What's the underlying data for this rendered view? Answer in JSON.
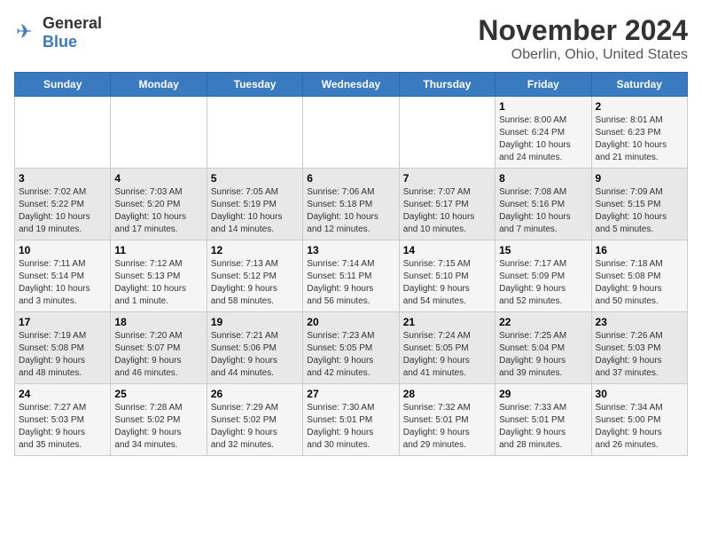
{
  "app": {
    "logo_general": "General",
    "logo_blue": "Blue"
  },
  "title": "November 2024",
  "subtitle": "Oberlin, Ohio, United States",
  "days_of_week": [
    "Sunday",
    "Monday",
    "Tuesday",
    "Wednesday",
    "Thursday",
    "Friday",
    "Saturday"
  ],
  "weeks": [
    [
      {
        "day": "",
        "info": ""
      },
      {
        "day": "",
        "info": ""
      },
      {
        "day": "",
        "info": ""
      },
      {
        "day": "",
        "info": ""
      },
      {
        "day": "",
        "info": ""
      },
      {
        "day": "1",
        "info": "Sunrise: 8:00 AM\nSunset: 6:24 PM\nDaylight: 10 hours\nand 24 minutes."
      },
      {
        "day": "2",
        "info": "Sunrise: 8:01 AM\nSunset: 6:23 PM\nDaylight: 10 hours\nand 21 minutes."
      }
    ],
    [
      {
        "day": "3",
        "info": "Sunrise: 7:02 AM\nSunset: 5:22 PM\nDaylight: 10 hours\nand 19 minutes."
      },
      {
        "day": "4",
        "info": "Sunrise: 7:03 AM\nSunset: 5:20 PM\nDaylight: 10 hours\nand 17 minutes."
      },
      {
        "day": "5",
        "info": "Sunrise: 7:05 AM\nSunset: 5:19 PM\nDaylight: 10 hours\nand 14 minutes."
      },
      {
        "day": "6",
        "info": "Sunrise: 7:06 AM\nSunset: 5:18 PM\nDaylight: 10 hours\nand 12 minutes."
      },
      {
        "day": "7",
        "info": "Sunrise: 7:07 AM\nSunset: 5:17 PM\nDaylight: 10 hours\nand 10 minutes."
      },
      {
        "day": "8",
        "info": "Sunrise: 7:08 AM\nSunset: 5:16 PM\nDaylight: 10 hours\nand 7 minutes."
      },
      {
        "day": "9",
        "info": "Sunrise: 7:09 AM\nSunset: 5:15 PM\nDaylight: 10 hours\nand 5 minutes."
      }
    ],
    [
      {
        "day": "10",
        "info": "Sunrise: 7:11 AM\nSunset: 5:14 PM\nDaylight: 10 hours\nand 3 minutes."
      },
      {
        "day": "11",
        "info": "Sunrise: 7:12 AM\nSunset: 5:13 PM\nDaylight: 10 hours\nand 1 minute."
      },
      {
        "day": "12",
        "info": "Sunrise: 7:13 AM\nSunset: 5:12 PM\nDaylight: 9 hours\nand 58 minutes."
      },
      {
        "day": "13",
        "info": "Sunrise: 7:14 AM\nSunset: 5:11 PM\nDaylight: 9 hours\nand 56 minutes."
      },
      {
        "day": "14",
        "info": "Sunrise: 7:15 AM\nSunset: 5:10 PM\nDaylight: 9 hours\nand 54 minutes."
      },
      {
        "day": "15",
        "info": "Sunrise: 7:17 AM\nSunset: 5:09 PM\nDaylight: 9 hours\nand 52 minutes."
      },
      {
        "day": "16",
        "info": "Sunrise: 7:18 AM\nSunset: 5:08 PM\nDaylight: 9 hours\nand 50 minutes."
      }
    ],
    [
      {
        "day": "17",
        "info": "Sunrise: 7:19 AM\nSunset: 5:08 PM\nDaylight: 9 hours\nand 48 minutes."
      },
      {
        "day": "18",
        "info": "Sunrise: 7:20 AM\nSunset: 5:07 PM\nDaylight: 9 hours\nand 46 minutes."
      },
      {
        "day": "19",
        "info": "Sunrise: 7:21 AM\nSunset: 5:06 PM\nDaylight: 9 hours\nand 44 minutes."
      },
      {
        "day": "20",
        "info": "Sunrise: 7:23 AM\nSunset: 5:05 PM\nDaylight: 9 hours\nand 42 minutes."
      },
      {
        "day": "21",
        "info": "Sunrise: 7:24 AM\nSunset: 5:05 PM\nDaylight: 9 hours\nand 41 minutes."
      },
      {
        "day": "22",
        "info": "Sunrise: 7:25 AM\nSunset: 5:04 PM\nDaylight: 9 hours\nand 39 minutes."
      },
      {
        "day": "23",
        "info": "Sunrise: 7:26 AM\nSunset: 5:03 PM\nDaylight: 9 hours\nand 37 minutes."
      }
    ],
    [
      {
        "day": "24",
        "info": "Sunrise: 7:27 AM\nSunset: 5:03 PM\nDaylight: 9 hours\nand 35 minutes."
      },
      {
        "day": "25",
        "info": "Sunrise: 7:28 AM\nSunset: 5:02 PM\nDaylight: 9 hours\nand 34 minutes."
      },
      {
        "day": "26",
        "info": "Sunrise: 7:29 AM\nSunset: 5:02 PM\nDaylight: 9 hours\nand 32 minutes."
      },
      {
        "day": "27",
        "info": "Sunrise: 7:30 AM\nSunset: 5:01 PM\nDaylight: 9 hours\nand 30 minutes."
      },
      {
        "day": "28",
        "info": "Sunrise: 7:32 AM\nSunset: 5:01 PM\nDaylight: 9 hours\nand 29 minutes."
      },
      {
        "day": "29",
        "info": "Sunrise: 7:33 AM\nSunset: 5:01 PM\nDaylight: 9 hours\nand 28 minutes."
      },
      {
        "day": "30",
        "info": "Sunrise: 7:34 AM\nSunset: 5:00 PM\nDaylight: 9 hours\nand 26 minutes."
      }
    ]
  ]
}
